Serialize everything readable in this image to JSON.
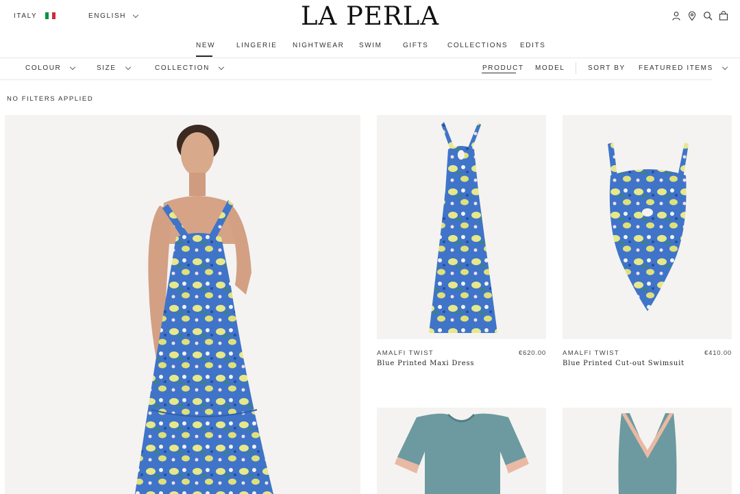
{
  "header": {
    "country": "ITALY",
    "language": "ENGLISH",
    "brand": "LA PERLA",
    "icons": [
      "account-icon",
      "location-icon",
      "search-icon",
      "bag-icon"
    ],
    "flag_colors": [
      "#009246",
      "#ffffff",
      "#ce2b37"
    ]
  },
  "nav": {
    "items": [
      "NEW",
      "LINGERIE",
      "NIGHTWEAR",
      "SWIM",
      "GIFTS",
      "COLLECTIONS",
      "EDITS"
    ],
    "active": "NEW"
  },
  "filters": {
    "colour": "COLOUR",
    "size": "SIZE",
    "collection": "COLLECTION",
    "view_product": "PRODUCT",
    "view_model": "MODEL",
    "sort_label": "SORT BY",
    "sort_value": "FEATURED ITEMS",
    "status": "NO FILTERS APPLIED"
  },
  "products": [
    {
      "collection": "AMALFI TWIST",
      "name": "Blue Printed Maxi Dress",
      "price": "€620.00"
    },
    {
      "collection": "AMALFI TWIST",
      "name": "Blue Printed Cut-out Swimsuit",
      "price": "€410.00"
    }
  ],
  "colors": {
    "print_blue": "#3f74c9",
    "lemon": "#e6e88a",
    "sage": "#6c9aa0",
    "lace": "#e9b9a3"
  }
}
